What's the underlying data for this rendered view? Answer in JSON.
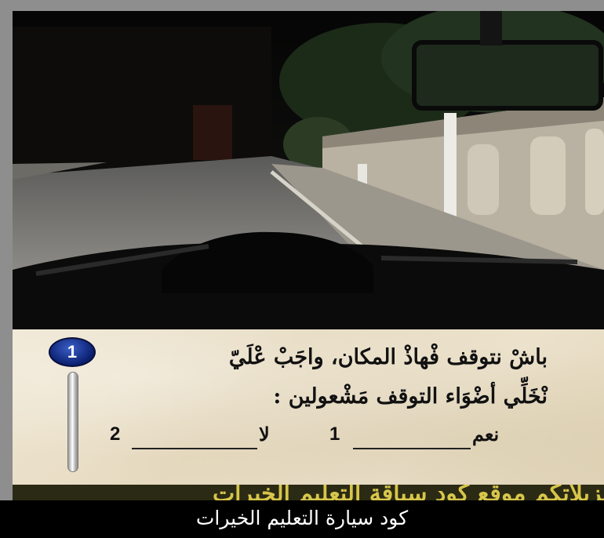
{
  "question": {
    "number": "1",
    "line1": "باشْ نتوقف  فْهاذْ المكان، واجَبْ عْلَيّ",
    "line2": "نْخَلِّي أضْوَاء التوقف مَشْعولين :",
    "options": [
      {
        "label": "نعم",
        "key": "1"
      },
      {
        "label": "لا",
        "key": "2"
      }
    ]
  },
  "bottom_strip_text": "تنزيلاتكم موقع كود سياقة التعليم الخيرات",
  "caption": "كود سيارة التعليم الخيرات",
  "colors": {
    "badge": "#1a3a9e",
    "strip_text": "#d7c64a",
    "caption_bg": "#000000"
  }
}
